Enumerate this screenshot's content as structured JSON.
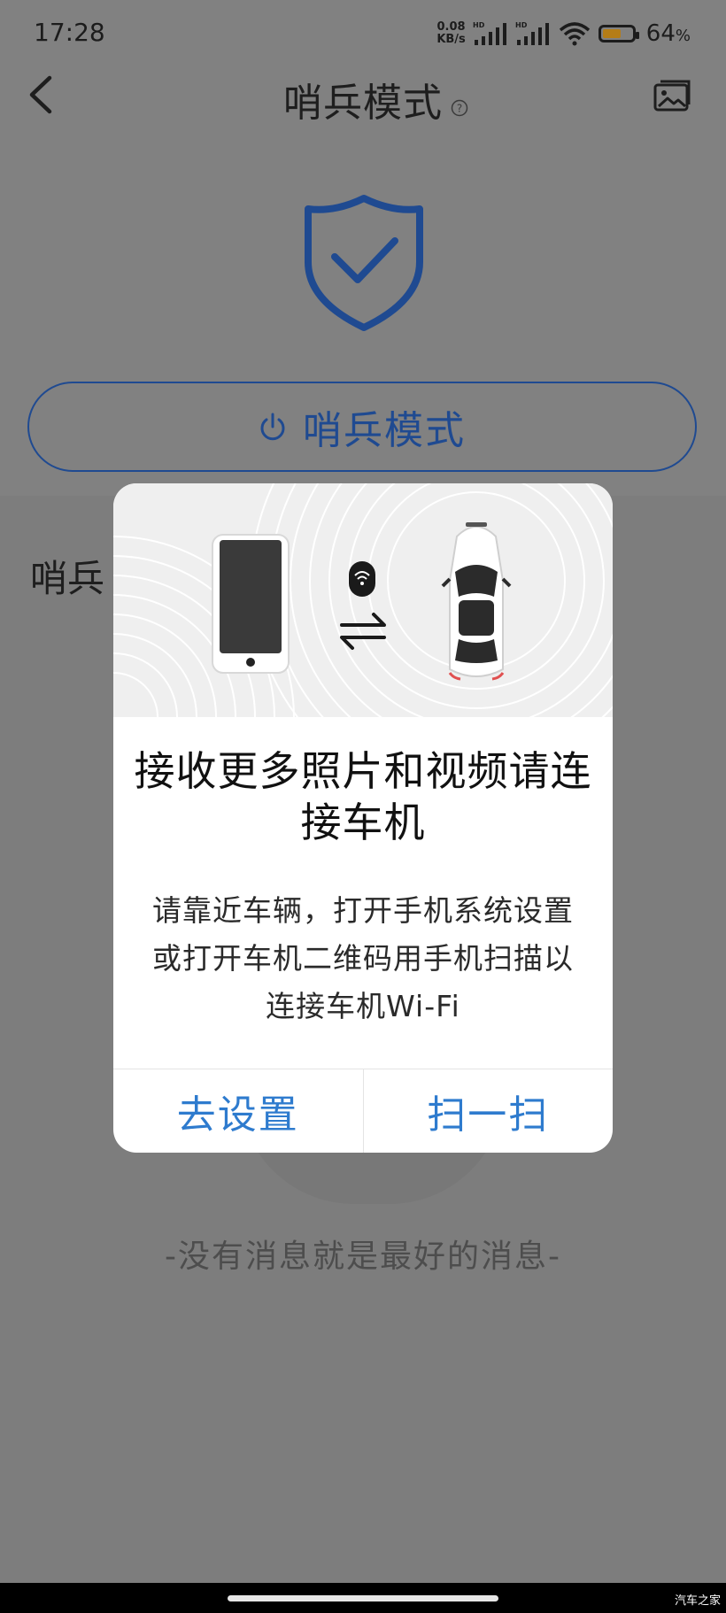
{
  "status_bar": {
    "time": "17:28",
    "net_speed_value": "0.08",
    "net_speed_unit": "KB/s",
    "hd_label": "HD",
    "battery_percent": "64",
    "battery_suffix": "%",
    "battery_level": 0.64,
    "battery_color": "#b57d17"
  },
  "header": {
    "title": "哨兵模式",
    "back_icon": "chevron-left-icon",
    "help_icon": "question-circle-icon",
    "gallery_icon": "image-gallery-icon"
  },
  "main": {
    "shield_icon": "shield-check-icon",
    "mode_button_label": "哨兵模式",
    "mode_button_icon": "power-icon",
    "section_label_partial": "哨兵",
    "empty_message": "-没有消息就是最好的消息-",
    "accent_color": "#1f4a91"
  },
  "dialog": {
    "illustration": {
      "phone_icon": "smartphone-icon",
      "wifi_icon": "wifi-icon",
      "transfer_icon": "swap-arrows-icon",
      "car_icon": "car-top-view-icon"
    },
    "title": "接收更多照片和视频请连接车机",
    "body": "请靠近车辆，打开手机系统设置或打开车机二维码用手机扫描以连接车机Wi-Fi",
    "actions": [
      {
        "label": "去设置"
      },
      {
        "label": "扫一扫"
      }
    ],
    "action_color": "#2e7bce"
  },
  "watermark": "汽车之家"
}
